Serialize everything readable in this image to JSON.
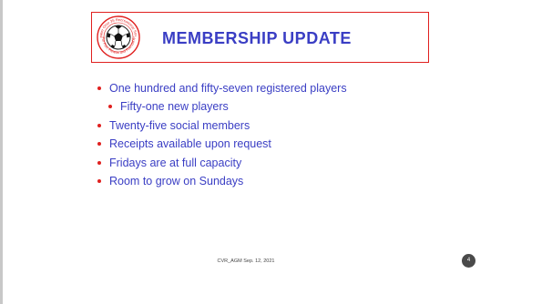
{
  "slide": {
    "title": "MEMBERSHIP UPDATE",
    "logo": {
      "icon": "soccer-ball-logo-icon",
      "ring_text_top": "Greater Ohio 35 Recreational Soccer",
      "ring_text_bottom": "For Fun, Fitness and Friendship"
    },
    "bullets": [
      {
        "text": "One hundred and fifty-seven registered players",
        "level": 1
      },
      {
        "text": "Fifty-one new players",
        "level": 2
      },
      {
        "text": "Twenty-five social members",
        "level": 1
      },
      {
        "text": "Receipts available upon request",
        "level": 1
      },
      {
        "text": "Fridays are at full capacity",
        "level": 1
      },
      {
        "text": "Room to grow on Sundays",
        "level": 1
      }
    ],
    "footer": "CVR_AGM Sep. 12, 2021",
    "page_number": "4",
    "colors": {
      "title": "#3a3ec4",
      "bullet_text": "#3a3ec4",
      "bullet_marker": "#e0201f",
      "title_border": "#e0201f"
    }
  }
}
